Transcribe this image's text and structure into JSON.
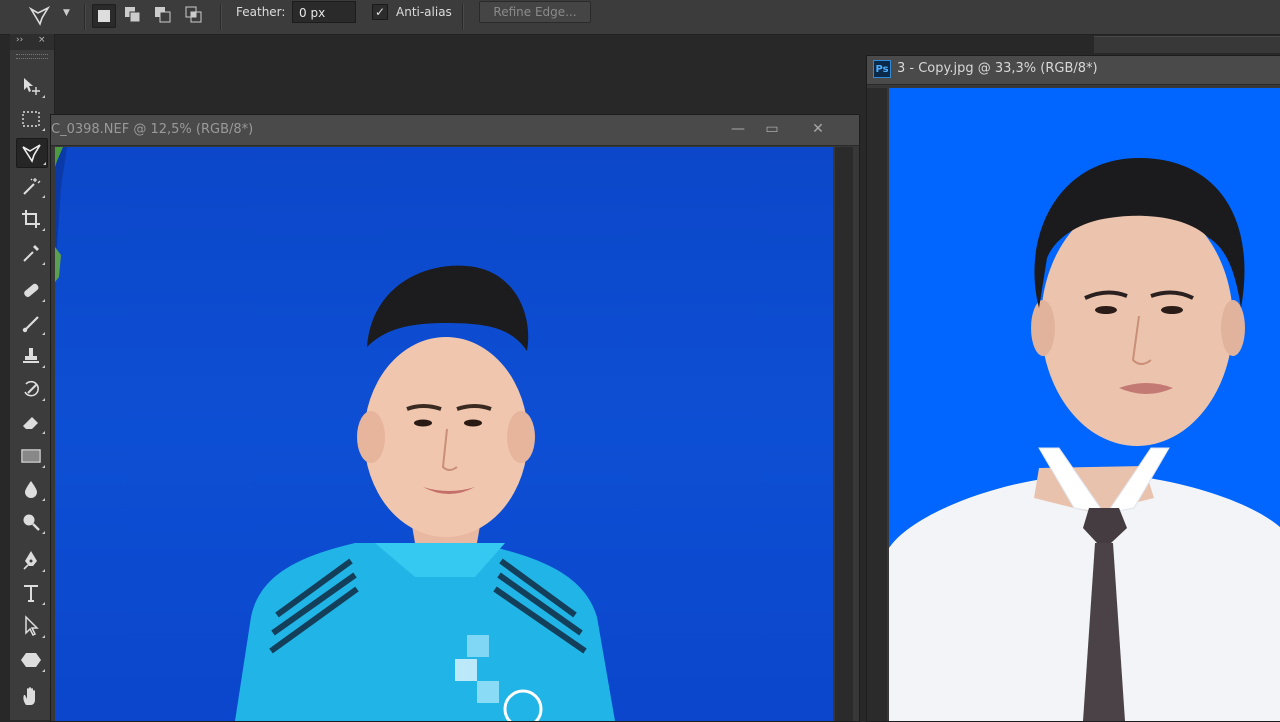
{
  "options_bar": {
    "tool_icon": "polygonal-lasso-icon",
    "selection_modes": [
      "new-selection-icon",
      "add-to-selection-icon",
      "subtract-from-selection-icon",
      "intersect-selection-icon"
    ],
    "feather_label": "Feather:",
    "feather_value": "0 px",
    "antialias_label": "Anti-alias",
    "antialias_checked": true,
    "refine_edge_label": "Refine Edge..."
  },
  "toolbox": {
    "header_expand": "››",
    "header_close": "×",
    "tools": [
      {
        "name": "move-tool",
        "icon": "move-icon"
      },
      {
        "name": "marquee-tool",
        "icon": "rect-marquee-icon"
      },
      {
        "name": "lasso-tool",
        "icon": "polygonal-lasso-icon",
        "active": true
      },
      {
        "name": "magic-wand-tool",
        "icon": "magic-wand-icon"
      },
      {
        "name": "crop-tool",
        "icon": "crop-icon"
      },
      {
        "name": "eyedropper-tool",
        "icon": "eyedropper-icon"
      },
      {
        "name": "healing-brush-tool",
        "icon": "bandage-icon"
      },
      {
        "name": "brush-tool",
        "icon": "brush-icon"
      },
      {
        "name": "clone-stamp-tool",
        "icon": "stamp-icon"
      },
      {
        "name": "history-brush-tool",
        "icon": "history-brush-icon"
      },
      {
        "name": "eraser-tool",
        "icon": "eraser-icon"
      },
      {
        "name": "gradient-tool",
        "icon": "gradient-icon"
      },
      {
        "name": "blur-tool",
        "icon": "drop-icon"
      },
      {
        "name": "dodge-tool",
        "icon": "dodge-icon"
      },
      {
        "name": "pen-tool",
        "icon": "pen-icon"
      },
      {
        "name": "type-tool",
        "icon": "type-icon"
      },
      {
        "name": "path-selection-tool",
        "icon": "arrow-icon"
      },
      {
        "name": "shape-tool",
        "icon": "hexagon-icon"
      },
      {
        "name": "hand-tool",
        "icon": "hand-icon"
      }
    ]
  },
  "documents": [
    {
      "title": "C_0398.NEF @ 12,5% (RGB/8*)",
      "minimize": "—",
      "maximize": "▭",
      "close": "✕"
    },
    {
      "badge": "Ps",
      "title": "3 - Copy.jpg @ 33,3% (RGB/8*)"
    }
  ],
  "colors": {
    "blue_backdrop_1": "#0c4ad0",
    "blue_backdrop_2": "#0066ff",
    "panel": "#3c3c3c"
  }
}
